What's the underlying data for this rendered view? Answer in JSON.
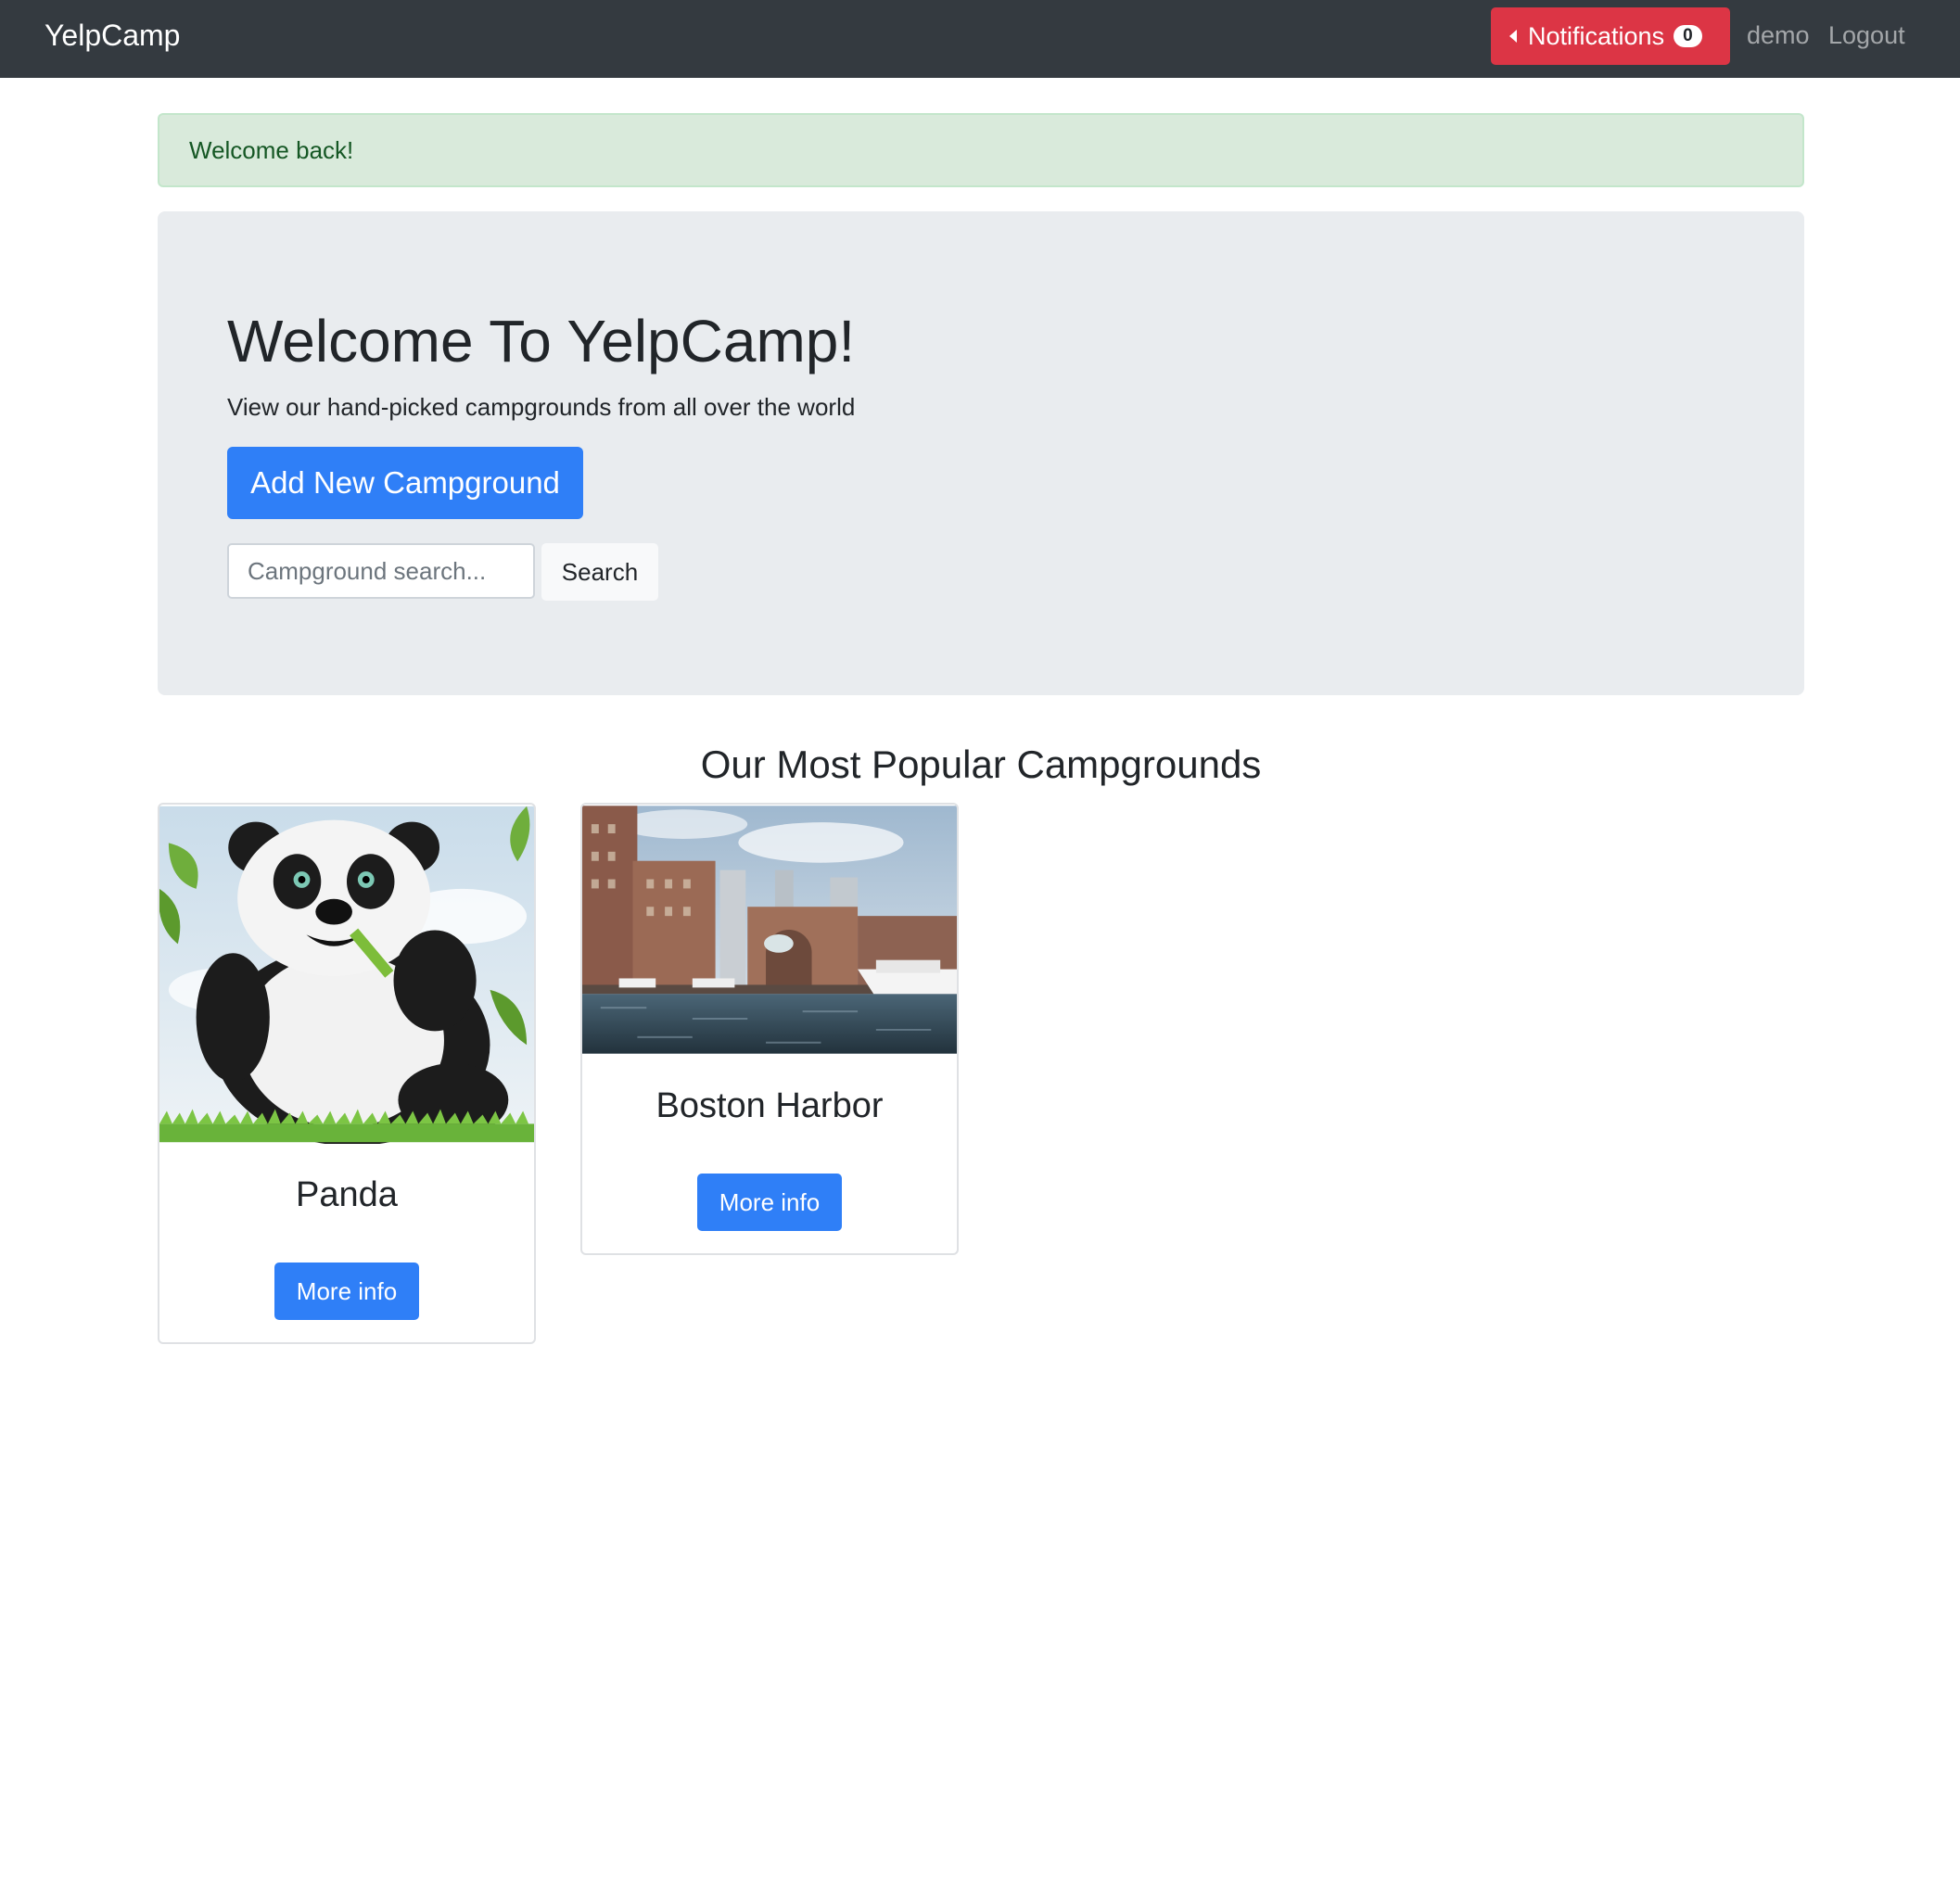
{
  "navbar": {
    "brand": "YelpCamp",
    "notifications_label": "Notifications",
    "notifications_count": "0",
    "user": "demo",
    "logout": "Logout"
  },
  "alert": {
    "message": "Welcome back!"
  },
  "jumbotron": {
    "title": "Welcome To YelpCamp!",
    "subtitle": "View our hand-picked campgrounds from all over the world",
    "add_button": "Add New Campground",
    "search_placeholder": "Campground search...",
    "search_button": "Search"
  },
  "section": {
    "title": "Our Most Popular Campgrounds"
  },
  "campgrounds": [
    {
      "name": "Panda",
      "button": "More info"
    },
    {
      "name": "Boston Harbor",
      "button": "More info"
    }
  ],
  "colors": {
    "navbar": "#343a40",
    "danger": "#dc3545",
    "primary": "#2f7ff7",
    "alert_bg": "#d9eadb",
    "jumbotron_bg": "#e9ecef"
  }
}
